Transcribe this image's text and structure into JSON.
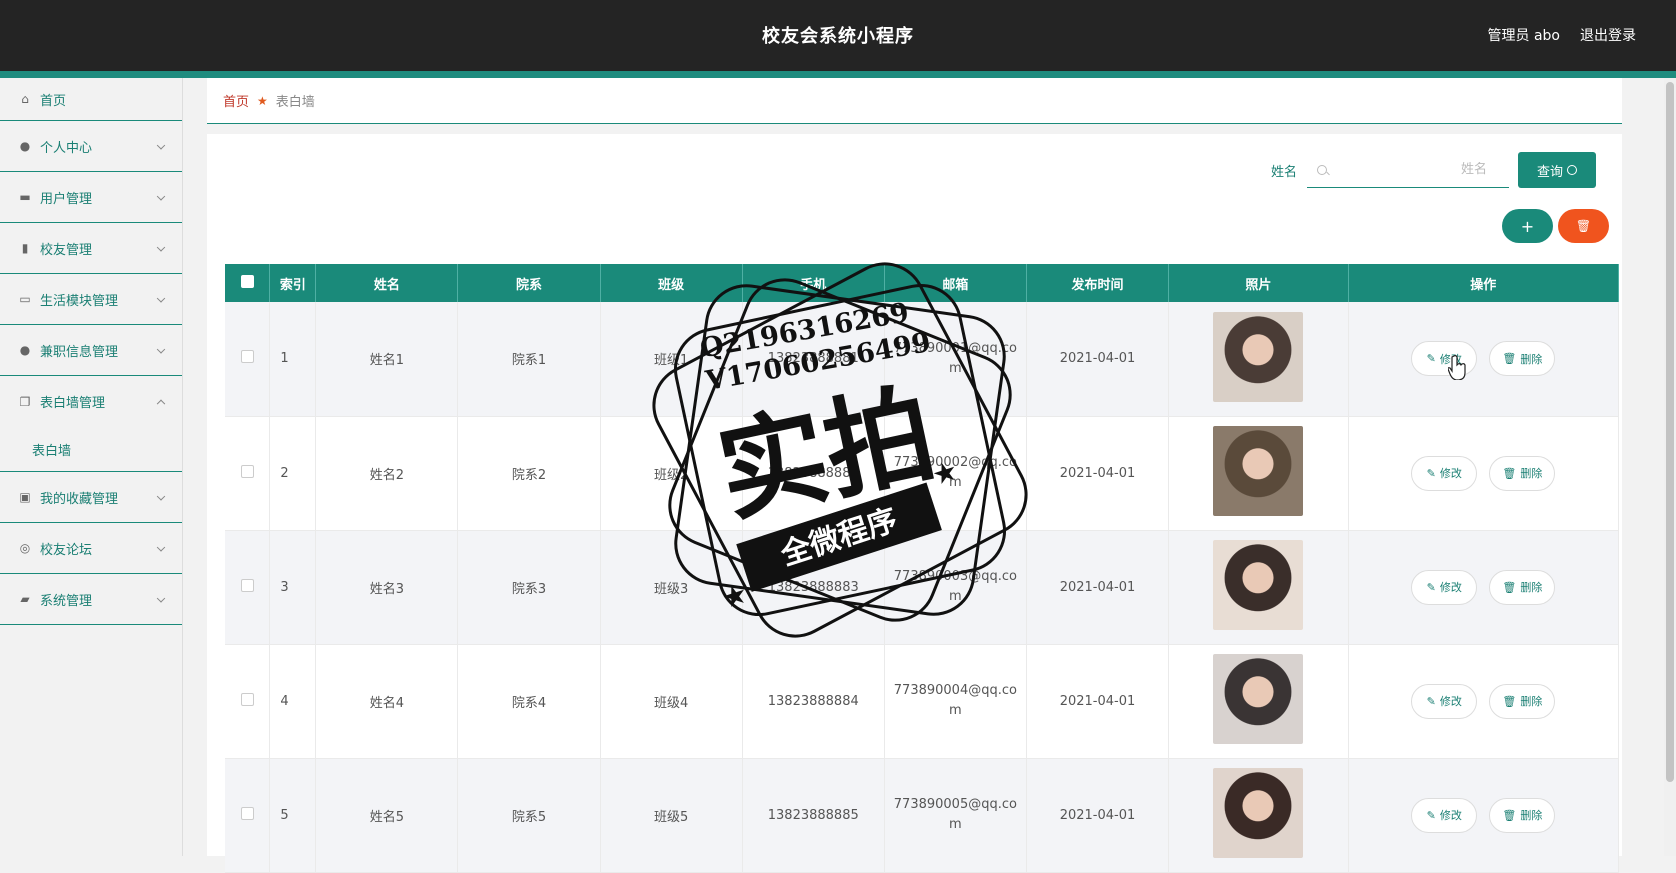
{
  "header": {
    "title": "校友会系统小程序",
    "admin": "管理员 abo",
    "logout": "退出登录"
  },
  "sidebar": {
    "items": [
      {
        "label": "首页",
        "icon": "home-icon"
      },
      {
        "label": "个人中心",
        "icon": "user-icon"
      },
      {
        "label": "用户管理",
        "icon": "briefcase-icon"
      },
      {
        "label": "校友管理",
        "icon": "clipboard-icon"
      },
      {
        "label": "生活模块管理",
        "icon": "card-icon"
      },
      {
        "label": "兼职信息管理",
        "icon": "person-icon"
      },
      {
        "label": "表白墙管理",
        "icon": "copy-icon"
      },
      {
        "label": "我的收藏管理",
        "icon": "chat-icon"
      },
      {
        "label": "校友论坛",
        "icon": "compass-icon"
      },
      {
        "label": "系统管理",
        "icon": "ticket-icon"
      }
    ],
    "sub_item": "表白墙"
  },
  "breadcrumb": {
    "home": "首页",
    "current": "表白墙"
  },
  "search": {
    "label": "姓名",
    "placeholder": "姓名",
    "button": "查询"
  },
  "toolbar": {
    "add": "+",
    "delete": "🗑"
  },
  "table": {
    "headers": [
      "索引",
      "姓名",
      "院系",
      "班级",
      "手机",
      "邮箱",
      "发布时间",
      "照片",
      "操作"
    ],
    "rows": [
      {
        "index": "1",
        "name": "姓名1",
        "dept": "院系1",
        "class": "班级1",
        "phone": "13823888881",
        "email1": "773890001@qq.co",
        "email2": "m",
        "time": "2021-04-01"
      },
      {
        "index": "2",
        "name": "姓名2",
        "dept": "院系2",
        "class": "班级2",
        "phone": "13823888882",
        "email1": "773890002@qq.co",
        "email2": "m",
        "time": "2021-04-01"
      },
      {
        "index": "3",
        "name": "姓名3",
        "dept": "院系3",
        "class": "班级3",
        "phone": "13823888883",
        "email1": "773890003@qq.co",
        "email2": "m",
        "time": "2021-04-01"
      },
      {
        "index": "4",
        "name": "姓名4",
        "dept": "院系4",
        "class": "班级4",
        "phone": "13823888884",
        "email1": "773890004@qq.co",
        "email2": "m",
        "time": "2021-04-01"
      },
      {
        "index": "5",
        "name": "姓名5",
        "dept": "院系5",
        "class": "班级5",
        "phone": "13823888885",
        "email1": "773890005@qq.co",
        "email2": "m",
        "time": "2021-04-01"
      }
    ],
    "edit_label": "修改",
    "delete_label": "删除"
  },
  "watermark": {
    "line1": "Q2196316269",
    "line2": "V17060256499",
    "big": "实拍",
    "banner": "全微程序"
  },
  "colors": {
    "accent": "#1a8a7a",
    "danger": "#f0541e",
    "topbar": "#242424"
  }
}
